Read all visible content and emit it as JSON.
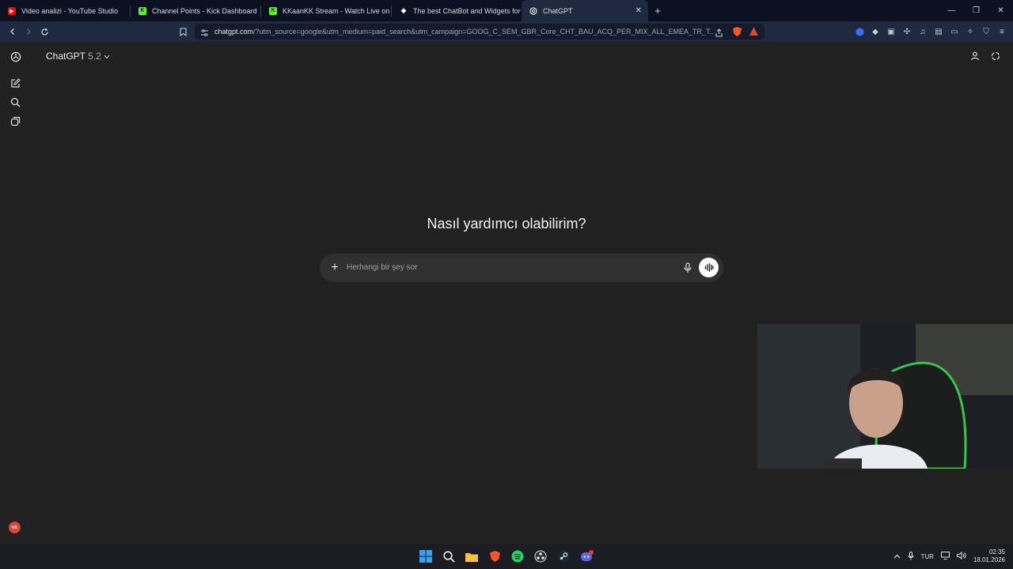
{
  "browser": {
    "tabs": [
      {
        "title": "Video analizi - YouTube Studio",
        "favicon": "youtube-icon",
        "color": "#ff0000"
      },
      {
        "title": "Channel Points - Kick Dashboard",
        "favicon": "kick-icon",
        "color": "#53fc18"
      },
      {
        "title": "KKaanKK Stream - Watch Live on Kick",
        "favicon": "kick-icon",
        "color": "#53fc18"
      },
      {
        "title": "The best ChatBot and Widgets for Kic",
        "favicon": "botrix-icon",
        "color": "#ffffff"
      },
      {
        "title": "ChatGPT",
        "favicon": "chatgpt-icon",
        "color": "#ffffff",
        "active": true
      }
    ],
    "new_tab": "+",
    "url_host": "chatgpt.com",
    "url_rest": "/?utm_source=google&utm_medium=paid_search&utm_campaign=GOOG_C_SEM_GBR_Core_CHT_BAU_ACQ_PER_MIX_ALL_EMEA_TR_T..."
  },
  "app": {
    "model_name": "ChatGPT",
    "model_version": "5.2",
    "headline": "Nasıl yardımcı olabilirim?",
    "composer_placeholder": "Herhangi bir şey sor",
    "avatar_initials": "KK"
  },
  "taskbar": {
    "language": "TUR",
    "time": "02:35",
    "date": "18.01.2026"
  },
  "colors": {
    "page_bg": "#212121",
    "composer_bg": "#303030",
    "browser_bar": "#1f2a40",
    "tab_strip": "#0b1120",
    "avatar": "#d9463c"
  }
}
